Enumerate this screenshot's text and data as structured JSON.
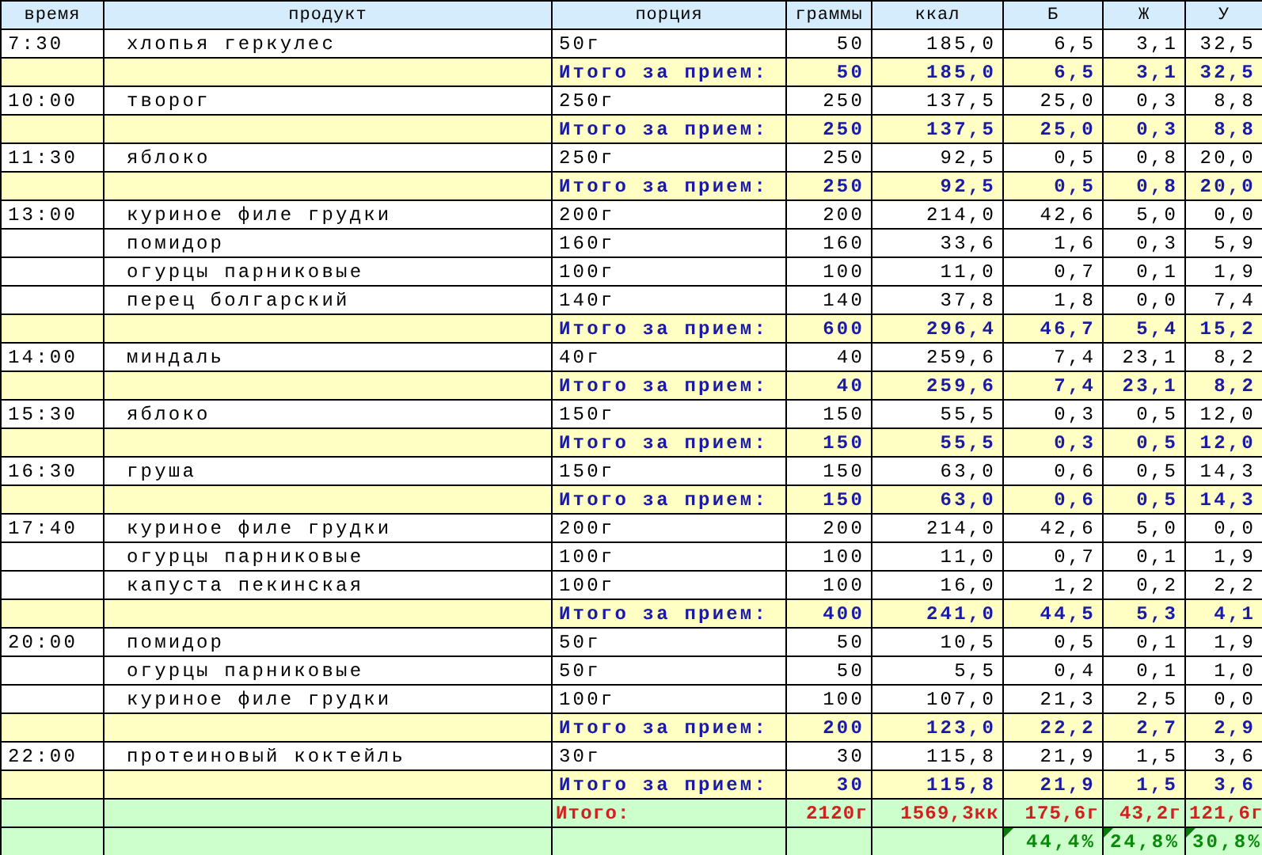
{
  "columns": [
    "время",
    "продукт",
    "порция",
    "граммы",
    "ккал",
    "Б",
    "Ж",
    "У"
  ],
  "meals": [
    {
      "time": "7:30",
      "items": [
        {
          "product": "хлопья геркулес",
          "portion": "50г",
          "grams": "50",
          "kcal": "185,0",
          "b": "6,5",
          "zh": "3,1",
          "u": "32,5"
        }
      ],
      "subtotal": {
        "label": "Итого за прием:",
        "grams": "50",
        "kcal": "185,0",
        "b": "6,5",
        "zh": "3,1",
        "u": "32,5"
      }
    },
    {
      "time": "10:00",
      "items": [
        {
          "product": "творог",
          "portion": "250г",
          "grams": "250",
          "kcal": "137,5",
          "b": "25,0",
          "zh": "0,3",
          "u": "8,8"
        }
      ],
      "subtotal": {
        "label": "Итого за прием:",
        "grams": "250",
        "kcal": "137,5",
        "b": "25,0",
        "zh": "0,3",
        "u": "8,8"
      }
    },
    {
      "time": "11:30",
      "items": [
        {
          "product": "яблоко",
          "portion": "250г",
          "grams": "250",
          "kcal": "92,5",
          "b": "0,5",
          "zh": "0,8",
          "u": "20,0"
        }
      ],
      "subtotal": {
        "label": "Итого за прием:",
        "grams": "250",
        "kcal": "92,5",
        "b": "0,5",
        "zh": "0,8",
        "u": "20,0"
      }
    },
    {
      "time": "13:00",
      "items": [
        {
          "product": "куриное филе грудки",
          "portion": "200г",
          "grams": "200",
          "kcal": "214,0",
          "b": "42,6",
          "zh": "5,0",
          "u": "0,0"
        },
        {
          "product": "помидор",
          "portion": "160г",
          "grams": "160",
          "kcal": "33,6",
          "b": "1,6",
          "zh": "0,3",
          "u": "5,9"
        },
        {
          "product": "огурцы парниковые",
          "portion": "100г",
          "grams": "100",
          "kcal": "11,0",
          "b": "0,7",
          "zh": "0,1",
          "u": "1,9"
        },
        {
          "product": "перец болгарский",
          "portion": "140г",
          "grams": "140",
          "kcal": "37,8",
          "b": "1,8",
          "zh": "0,0",
          "u": "7,4"
        }
      ],
      "subtotal": {
        "label": "Итого за прием:",
        "grams": "600",
        "kcal": "296,4",
        "b": "46,7",
        "zh": "5,4",
        "u": "15,2"
      }
    },
    {
      "time": "14:00",
      "items": [
        {
          "product": "миндаль",
          "portion": "40г",
          "grams": "40",
          "kcal": "259,6",
          "b": "7,4",
          "zh": "23,1",
          "u": "8,2"
        }
      ],
      "subtotal": {
        "label": "Итого за прием:",
        "grams": "40",
        "kcal": "259,6",
        "b": "7,4",
        "zh": "23,1",
        "u": "8,2"
      }
    },
    {
      "time": "15:30",
      "items": [
        {
          "product": "яблоко",
          "portion": "150г",
          "grams": "150",
          "kcal": "55,5",
          "b": "0,3",
          "zh": "0,5",
          "u": "12,0"
        }
      ],
      "subtotal": {
        "label": "Итого за прием:",
        "grams": "150",
        "kcal": "55,5",
        "b": "0,3",
        "zh": "0,5",
        "u": "12,0"
      }
    },
    {
      "time": "16:30",
      "items": [
        {
          "product": "груша",
          "portion": "150г",
          "grams": "150",
          "kcal": "63,0",
          "b": "0,6",
          "zh": "0,5",
          "u": "14,3"
        }
      ],
      "subtotal": {
        "label": "Итого за прием:",
        "grams": "150",
        "kcal": "63,0",
        "b": "0,6",
        "zh": "0,5",
        "u": "14,3"
      }
    },
    {
      "time": "17:40",
      "items": [
        {
          "product": "куриное филе грудки",
          "portion": "200г",
          "grams": "200",
          "kcal": "214,0",
          "b": "42,6",
          "zh": "5,0",
          "u": "0,0"
        },
        {
          "product": "огурцы парниковые",
          "portion": "100г",
          "grams": "100",
          "kcal": "11,0",
          "b": "0,7",
          "zh": "0,1",
          "u": "1,9"
        },
        {
          "product": "капуста пекинская",
          "portion": "100г",
          "grams": "100",
          "kcal": "16,0",
          "b": "1,2",
          "zh": "0,2",
          "u": "2,2"
        }
      ],
      "subtotal": {
        "label": "Итого за прием:",
        "grams": "400",
        "kcal": "241,0",
        "b": "44,5",
        "zh": "5,3",
        "u": "4,1"
      }
    },
    {
      "time": "20:00",
      "items": [
        {
          "product": "помидор",
          "portion": "50г",
          "grams": "50",
          "kcal": "10,5",
          "b": "0,5",
          "zh": "0,1",
          "u": "1,9"
        },
        {
          "product": "огурцы парниковые",
          "portion": "50г",
          "grams": "50",
          "kcal": "5,5",
          "b": "0,4",
          "zh": "0,1",
          "u": "1,0"
        },
        {
          "product": "куриное филе грудки",
          "portion": "100г",
          "grams": "100",
          "kcal": "107,0",
          "b": "21,3",
          "zh": "2,5",
          "u": "0,0"
        }
      ],
      "subtotal": {
        "label": "Итого за прием:",
        "grams": "200",
        "kcal": "123,0",
        "b": "22,2",
        "zh": "2,7",
        "u": "2,9"
      }
    },
    {
      "time": "22:00",
      "items": [
        {
          "product": "протеиновый коктейль",
          "portion": "30г",
          "grams": "30",
          "kcal": "115,8",
          "b": "21,9",
          "zh": "1,5",
          "u": "3,6"
        }
      ],
      "subtotal": {
        "label": "Итого за прием:",
        "grams": "30",
        "kcal": "115,8",
        "b": "21,9",
        "zh": "1,5",
        "u": "3,6"
      }
    }
  ],
  "total": {
    "label": "Итого:",
    "grams": "2120г",
    "kcal": "1569,3кк",
    "b": "175,6г",
    "zh": "43,2г",
    "u": "121,6г"
  },
  "percent": {
    "b": "44,4%",
    "zh": "24,8%",
    "u": "30,8%"
  }
}
